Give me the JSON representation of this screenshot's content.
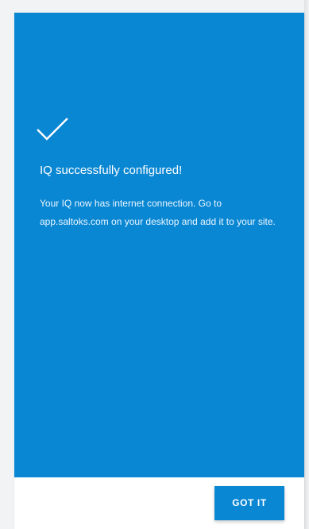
{
  "confirmation": {
    "icon": "check-icon",
    "title": "IQ successfully configured!",
    "message": "Your IQ now has internet connection. Go to app.saltoks.com on your desktop and add it to your site.",
    "accent_color": "#0a87d3"
  },
  "footer": {
    "button_label": "GOT IT"
  }
}
